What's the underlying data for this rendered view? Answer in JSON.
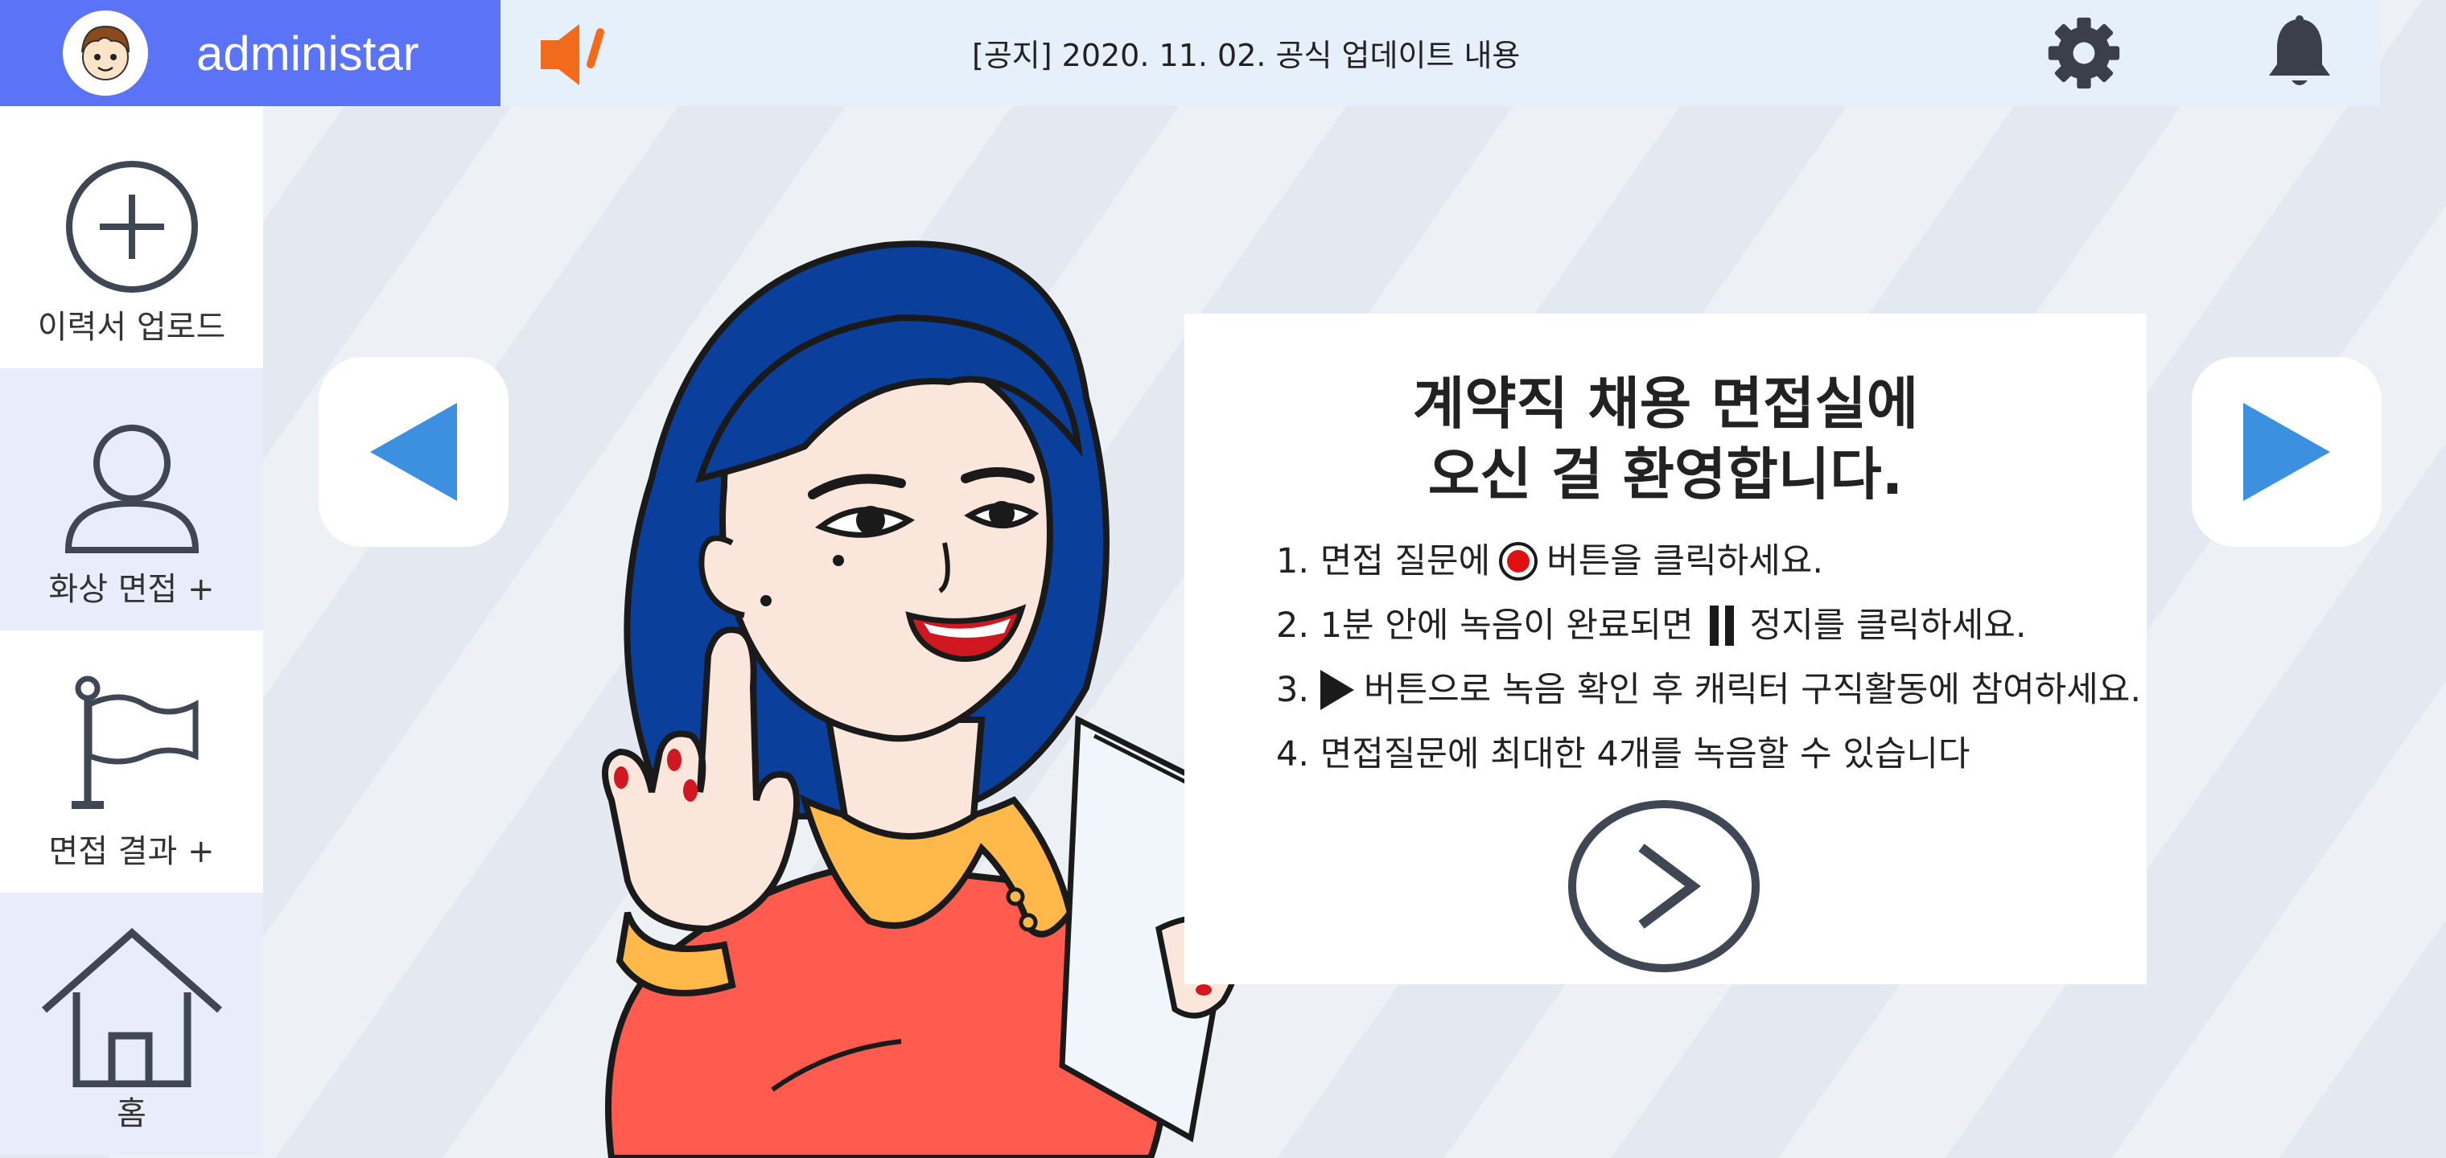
{
  "header": {
    "username": "administar",
    "notice": "[공지] 2020. 11. 02. 공식 업데이트 내용"
  },
  "sidebar": {
    "items": [
      {
        "label": "이력서 업로드",
        "icon": "plus-circle-icon"
      },
      {
        "label": "화상 면접 +",
        "icon": "user-icon"
      },
      {
        "label": "면접 결과 +",
        "icon": "flag-icon"
      },
      {
        "label": "홈",
        "icon": "home-icon"
      }
    ]
  },
  "card": {
    "title_line1": "계약직 채용 면접실에",
    "title_line2": "오신 걸 환영합니다.",
    "steps": [
      {
        "pre": "1. 면접 질문에",
        "post": "버튼을 클릭하세요."
      },
      {
        "pre": "2. 1분 안에 녹음이 완료되면",
        "post": "정지를 클릭하세요."
      },
      {
        "pre": "3.",
        "post": "버튼으로 녹음 확인 후 캐릭터 구직활동에 참여하세요."
      },
      {
        "pre": "4. 면접질문에 최대한 4개를 녹음할 수 있습니다",
        "post": ""
      }
    ]
  },
  "colors": {
    "accent_blue": "#5b73f7",
    "arrow_blue": "#3d8fe0",
    "notice_bg": "#e5f0fb",
    "record_red": "#e01010"
  }
}
